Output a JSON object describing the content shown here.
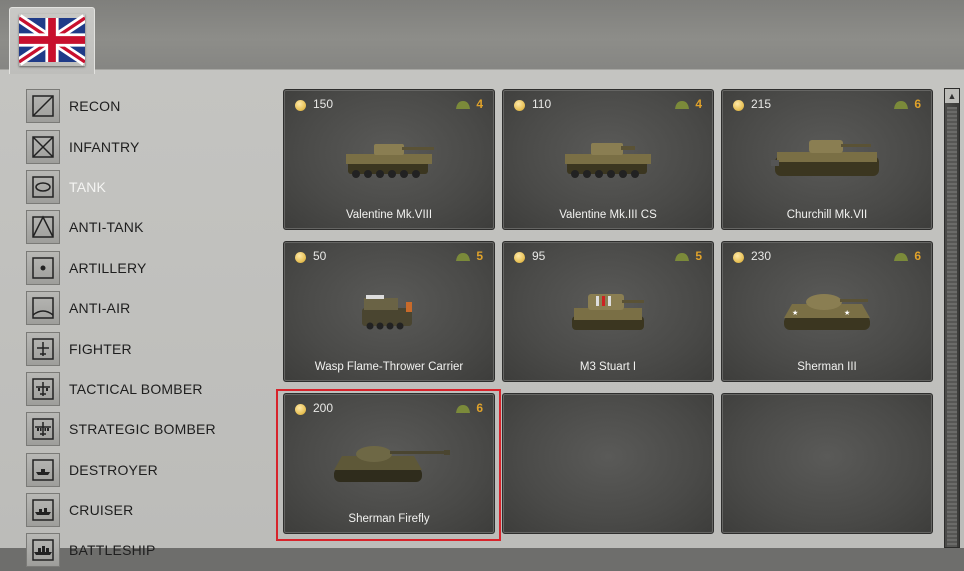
{
  "faction": {
    "flag_icon": "union-jack-flag-icon"
  },
  "categories": [
    {
      "label": "RECON",
      "icon": "recon-icon"
    },
    {
      "label": "INFANTRY",
      "icon": "infantry-icon"
    },
    {
      "label": "TANK",
      "icon": "tank-icon",
      "active": true
    },
    {
      "label": "ANTI-TANK",
      "icon": "anti-tank-icon"
    },
    {
      "label": "ARTILLERY",
      "icon": "artillery-icon"
    },
    {
      "label": "ANTI-AIR",
      "icon": "anti-air-icon"
    },
    {
      "label": "FIGHTER",
      "icon": "fighter-icon"
    },
    {
      "label": "TACTICAL BOMBER",
      "icon": "tactical-bomber-icon"
    },
    {
      "label": "STRATEGIC BOMBER",
      "icon": "strategic-bomber-icon"
    },
    {
      "label": "DESTROYER",
      "icon": "destroyer-icon"
    },
    {
      "label": "CRUISER",
      "icon": "cruiser-icon"
    },
    {
      "label": "BATTLESHIP",
      "icon": "battleship-icon"
    }
  ],
  "units": [
    {
      "name": "Valentine Mk.VIII",
      "cost": "150",
      "tier": "4"
    },
    {
      "name": "Valentine Mk.III CS",
      "cost": "110",
      "tier": "4"
    },
    {
      "name": "Churchill Mk.VII",
      "cost": "215",
      "tier": "6"
    },
    {
      "name": "Wasp Flame-Thrower Carrier",
      "cost": "50",
      "tier": "5"
    },
    {
      "name": "M3 Stuart I",
      "cost": "95",
      "tier": "5"
    },
    {
      "name": "Sherman III",
      "cost": "230",
      "tier": "6"
    },
    {
      "name": "Sherman Firefly",
      "cost": "200",
      "tier": "6",
      "selected": true
    },
    null,
    null
  ],
  "colors": {
    "selection": "#d7232b",
    "tier": "#e0a22a",
    "active_label": "#f4f4f2"
  }
}
